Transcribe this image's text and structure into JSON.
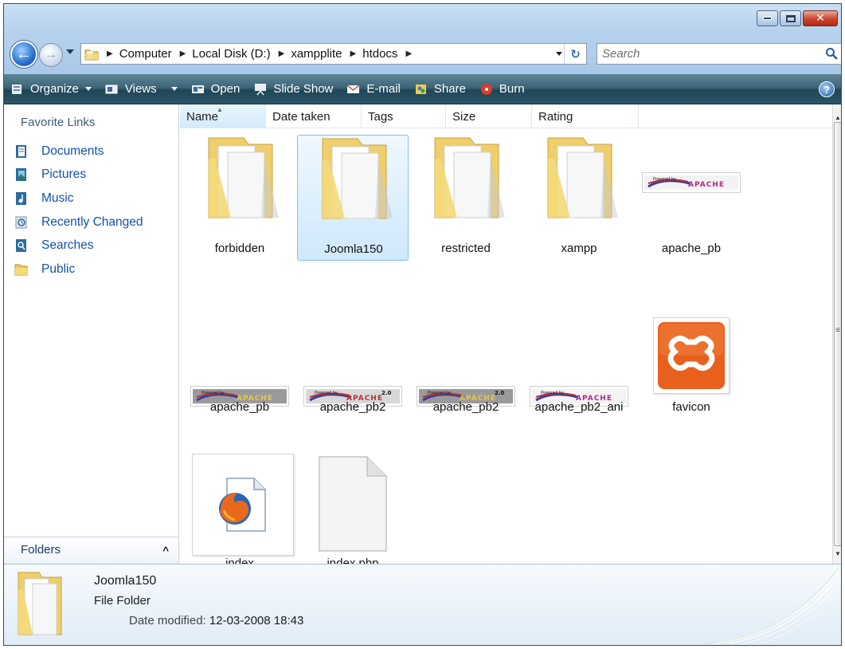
{
  "address": {
    "crumbs": [
      "Computer",
      "Local Disk (D:)",
      "xampplite",
      "htdocs"
    ]
  },
  "search": {
    "placeholder": "Search"
  },
  "toolbar": {
    "organize": "Organize",
    "views": "Views",
    "open": "Open",
    "slideshow": "Slide Show",
    "email": "E-mail",
    "share": "Share",
    "burn": "Burn"
  },
  "nav": {
    "heading": "Favorite Links",
    "items": [
      "Documents",
      "Pictures",
      "Music",
      "Recently Changed",
      "Searches",
      "Public"
    ],
    "folders_label": "Folders"
  },
  "columns": [
    "Name",
    "Date taken",
    "Tags",
    "Size",
    "Rating"
  ],
  "files": [
    {
      "name": "forbidden",
      "kind": "folder"
    },
    {
      "name": "Joomla150",
      "kind": "folder",
      "selected": true
    },
    {
      "name": "restricted",
      "kind": "folder"
    },
    {
      "name": "xampp",
      "kind": "folder"
    },
    {
      "name": "apache_pb",
      "kind": "apache-banner"
    },
    {
      "name": "apache_pb",
      "kind": "apache-banner"
    },
    {
      "name": "apache_pb2",
      "kind": "apache-banner-20"
    },
    {
      "name": "apache_pb2",
      "kind": "apache-banner-20"
    },
    {
      "name": "apache_pb2_ani",
      "kind": "apache-banner"
    },
    {
      "name": "favicon",
      "kind": "xampp-icon"
    },
    {
      "name": "index",
      "kind": "firefox-html"
    },
    {
      "name": "index.php",
      "kind": "blank-file"
    }
  ],
  "banner_text": {
    "powered": "Powered by",
    "apache": "APACHE",
    "version": "2.0"
  },
  "details": {
    "name": "Joomla150",
    "type": "File Folder",
    "date_label": "Date modified:",
    "date_value": "12-03-2008 18:43"
  },
  "colors": {
    "toolbar_dark": "#1f4657",
    "link_blue": "#1151a8",
    "selection_border": "#84c1ea",
    "xampp_orange": "#e8601c"
  }
}
